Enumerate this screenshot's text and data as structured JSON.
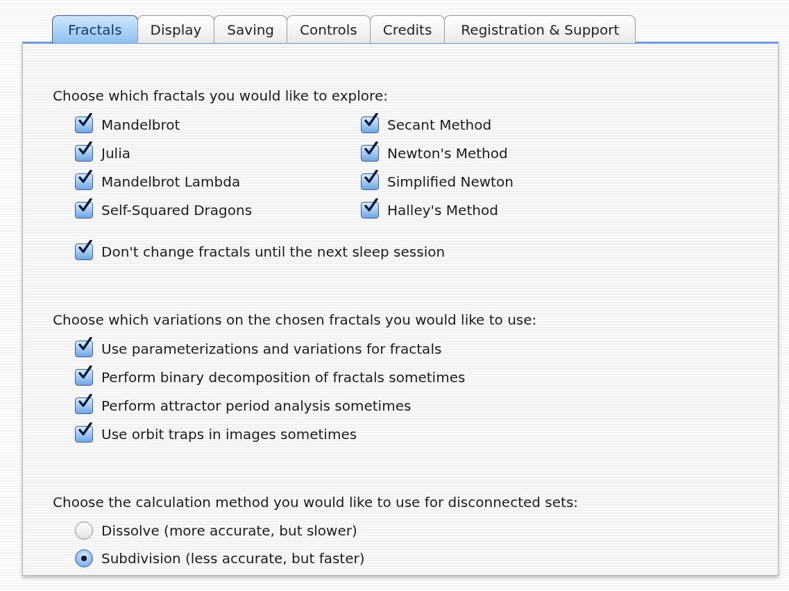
{
  "tabs": [
    {
      "label": "Fractals",
      "selected": true
    },
    {
      "label": "Display",
      "selected": false
    },
    {
      "label": "Saving",
      "selected": false
    },
    {
      "label": "Controls",
      "selected": false
    },
    {
      "label": "Credits",
      "selected": false
    },
    {
      "label": "Registration & Support",
      "selected": false
    }
  ],
  "sections": [
    {
      "heading": "Choose which fractals you would like to explore:",
      "groups": [
        {
          "kind": "columns",
          "columns": [
            [
              {
                "label": "Mandelbrot",
                "checked": true
              },
              {
                "label": "Julia",
                "checked": true
              },
              {
                "label": "Mandelbrot Lambda",
                "checked": true
              },
              {
                "label": "Self-Squared Dragons",
                "checked": true
              }
            ],
            [
              {
                "label": "Secant Method",
                "checked": true
              },
              {
                "label": "Newton's Method",
                "checked": true
              },
              {
                "label": "Simplified Newton",
                "checked": true
              },
              {
                "label": "Halley's Method",
                "checked": true
              }
            ]
          ]
        },
        {
          "kind": "list",
          "options": [
            {
              "label": "Don't change fractals until the next sleep session",
              "checked": true
            }
          ]
        }
      ]
    },
    {
      "heading": "Choose which variations on the chosen fractals you would like to use:",
      "groups": [
        {
          "kind": "list",
          "options": [
            {
              "label": "Use parameterizations and variations for fractals",
              "checked": true
            },
            {
              "label": "Perform binary decomposition of fractals sometimes",
              "checked": true
            },
            {
              "label": "Perform attractor period analysis sometimes",
              "checked": true
            },
            {
              "label": "Use orbit traps in images sometimes",
              "checked": true
            }
          ]
        }
      ]
    },
    {
      "heading": "Choose the calculation method you would like to use for disconnected sets:",
      "groups": [
        {
          "kind": "radios",
          "options": [
            {
              "label": "Dissolve (more accurate, but slower)",
              "selected": false
            },
            {
              "label": "Subdivision (less accurate, but faster)",
              "selected": true
            }
          ]
        }
      ]
    }
  ]
}
